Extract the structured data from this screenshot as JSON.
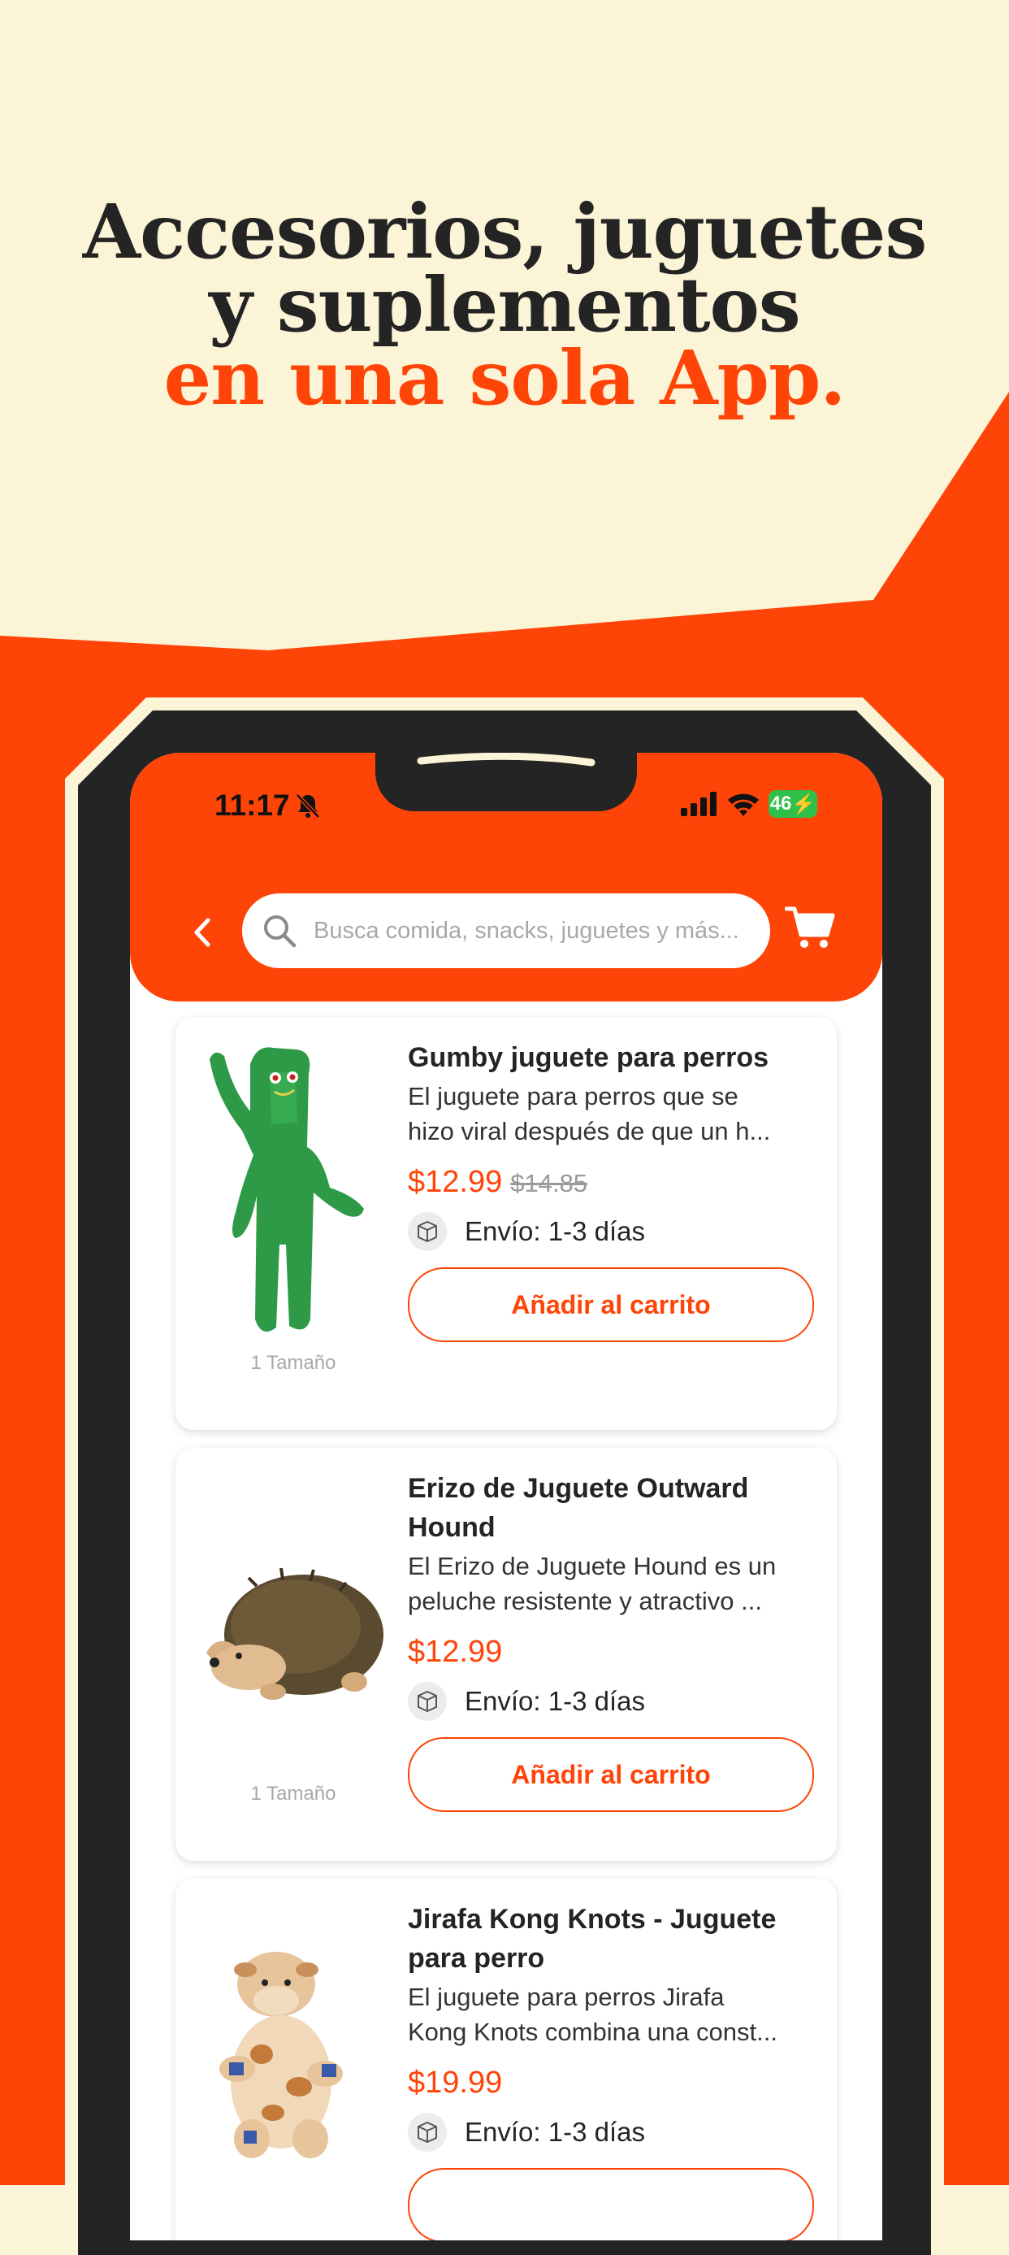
{
  "headline": {
    "line1": "Accesorios, juguetes",
    "line2": "y suplementos",
    "accent": "en una sola App."
  },
  "colors": {
    "brand_orange": "#ff4408",
    "cream": "#fcf4d6",
    "dark": "#242424"
  },
  "status_bar": {
    "time": "11:17",
    "battery": "46"
  },
  "header": {
    "back_icon": "chevron-left-icon",
    "search_placeholder": "Busca comida, snacks, juguetes y más...",
    "cart_icon": "cart-icon"
  },
  "products": [
    {
      "title": "Gumby juguete para perros",
      "desc_line1": "El juguete para perros que se",
      "desc_line2": "hizo viral después de que un h...",
      "price": "$12.99",
      "old_price": "$14.85",
      "shipping": "Envío: 1-3 días",
      "button": "Añadir al carrito",
      "size": "1 Tamaño"
    },
    {
      "title_line1": "Erizo de Juguete Outward",
      "title_line2": "Hound",
      "desc_line1": "El Erizo de Juguete Hound es un",
      "desc_line2": "peluche resistente y atractivo ...",
      "price": "$12.99",
      "shipping": "Envío: 1-3 días",
      "button": "Añadir al carrito",
      "size": "1 Tamaño"
    },
    {
      "title_line1": "Jirafa Kong Knots - Juguete",
      "title_line2": "para perro",
      "desc_line1": "El juguete para perros Jirafa",
      "desc_line2": "Kong Knots combina una const...",
      "price": "$19.99",
      "shipping": "Envío: 1-3 días"
    }
  ]
}
